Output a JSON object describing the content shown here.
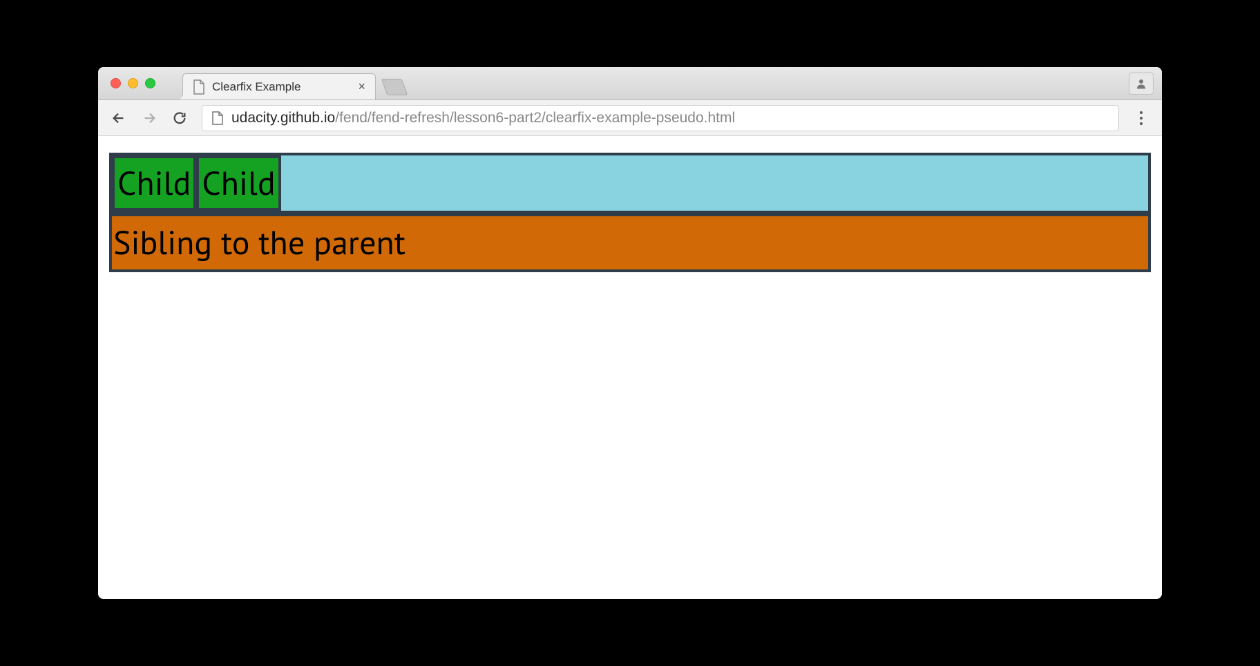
{
  "browser": {
    "tab_title": "Clearfix Example",
    "url_domain": "udacity.github.io",
    "url_path": "/fend/fend-refresh/lesson6-part2/clearfix-example-pseudo.html"
  },
  "page": {
    "child1_text": "Child",
    "child2_text": "Child",
    "sibling_text": "Sibling to the parent"
  },
  "colors": {
    "border": "#2e3d49",
    "parent_bg": "#89d2e0",
    "child_bg": "#15a222",
    "sibling_bg": "#d16906"
  }
}
